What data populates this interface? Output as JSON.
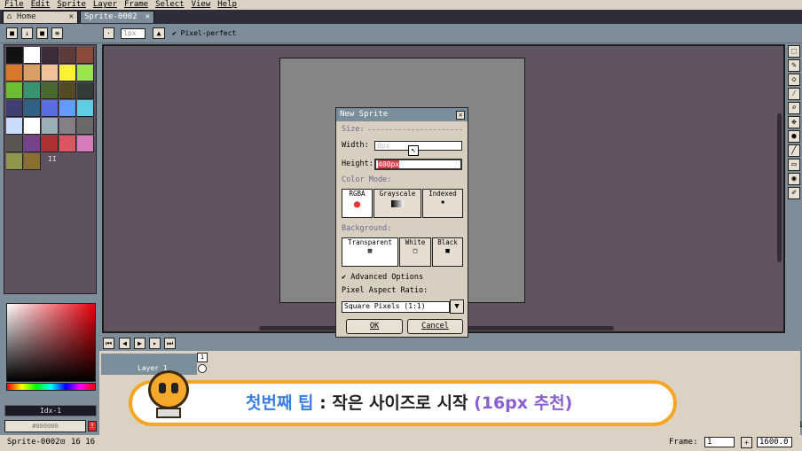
{
  "menu": {
    "items": [
      "File",
      "Edit",
      "Sprite",
      "Layer",
      "Frame",
      "Select",
      "View",
      "Help"
    ]
  },
  "tabs": [
    {
      "label": "Home"
    },
    {
      "label": "Sprite-0002"
    }
  ],
  "toolbar": {
    "brush_size": "1px",
    "pixel_perfect_label": "Pixel-perfect"
  },
  "palette": {
    "colors": [
      "#111111",
      "#ffffff",
      "#3b2b3b",
      "#5e3b3b",
      "#8a4b3b",
      "#d8782a",
      "#d9a066",
      "#eec39a",
      "#fbf236",
      "#99e550",
      "#6abe30",
      "#37946e",
      "#4b692f",
      "#524b24",
      "#323c39",
      "#3f3f74",
      "#306082",
      "#5b6ee1",
      "#639bff",
      "#5fcde4",
      "#cbdbfc",
      "#ffffff",
      "#9badb7",
      "#847e87",
      "#696a6a",
      "#595652",
      "#76428a",
      "#ac3232",
      "#d95763",
      "#d77bba",
      "#8f974a",
      "#8a6f30"
    ],
    "page_marker": "II"
  },
  "color": {
    "index_label": "Idx-1",
    "hex": "#000000"
  },
  "dialog": {
    "title": "New Sprite",
    "size_section": "Size:",
    "width_label": "Width:",
    "width_value": "0px",
    "height_label": "Height:",
    "height_value": "400px",
    "color_mode_section": "Color Mode:",
    "color_modes": [
      "RGBA",
      "Grayscale",
      "Indexed"
    ],
    "background_section": "Background:",
    "backgrounds": [
      "Transparent",
      "White",
      "Black"
    ],
    "advanced_label": "Advanced Options",
    "par_label": "Pixel Aspect Ratio:",
    "par_value": "Square Pixels (1:1)",
    "ok_label": "OK",
    "cancel_label": "Cancel"
  },
  "timeline": {
    "layer_name": "Layer 1",
    "frame_number": "1"
  },
  "banner": {
    "part1": "첫번째 팁",
    "part2": " : 작은 사이즈로 시작 ",
    "part3": "(16px 추천)"
  },
  "status": {
    "file": "Sprite-0002",
    "size": "16 16",
    "frame_label": "Frame:",
    "frame_value": "1",
    "zoom": "1600.0"
  }
}
